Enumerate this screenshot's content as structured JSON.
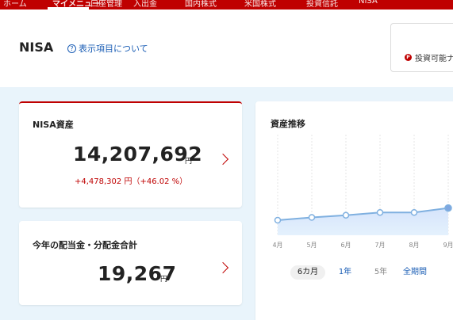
{
  "nav": {
    "tabs": [
      {
        "label": "ホーム"
      },
      {
        "label": "マイメニュー"
      },
      {
        "label": "口座管理"
      },
      {
        "label": "入出金"
      },
      {
        "label": "国内株式"
      },
      {
        "label": "米国株式"
      },
      {
        "label": "投資信託"
      },
      {
        "label": "NISA"
      }
    ]
  },
  "header": {
    "title": "NISA",
    "help_link": "表示項目について",
    "help_icon_glyph": "?",
    "buyable_label": "投資可能ナ",
    "buyable_icon_glyph": "P"
  },
  "nisa_card": {
    "label": "NISA資産",
    "value": "14,207,692",
    "unit": "円",
    "gain": "+4,478,302 円（+46.02 %）"
  },
  "dividend_card": {
    "label": "今年の配当金・分配金合計",
    "value": "19,267",
    "unit": "円"
  },
  "chart_card": {
    "title": "資産推移",
    "periods": [
      {
        "label": "6カ月",
        "state": "selected"
      },
      {
        "label": "1年",
        "state": "link"
      },
      {
        "label": "5年",
        "state": "muted"
      },
      {
        "label": "全期間",
        "state": "link"
      }
    ]
  },
  "colors": {
    "brand_red": "#bf0000",
    "link_blue": "#1b5eb5",
    "line": "#7fb0e0",
    "area_top": "#d9e6fb",
    "area_bottom": "#e3f0fd"
  },
  "chart_data": {
    "type": "area",
    "title": "資産推移",
    "x": [
      "4月",
      "5月",
      "6月",
      "7月",
      "8月",
      "9月"
    ],
    "series": [
      {
        "values": [
          12.0,
          12.5,
          12.9,
          13.4,
          13.4,
          14.2
        ]
      }
    ],
    "ylim": [
      0,
      20
    ],
    "grid": true,
    "legend": "none"
  }
}
